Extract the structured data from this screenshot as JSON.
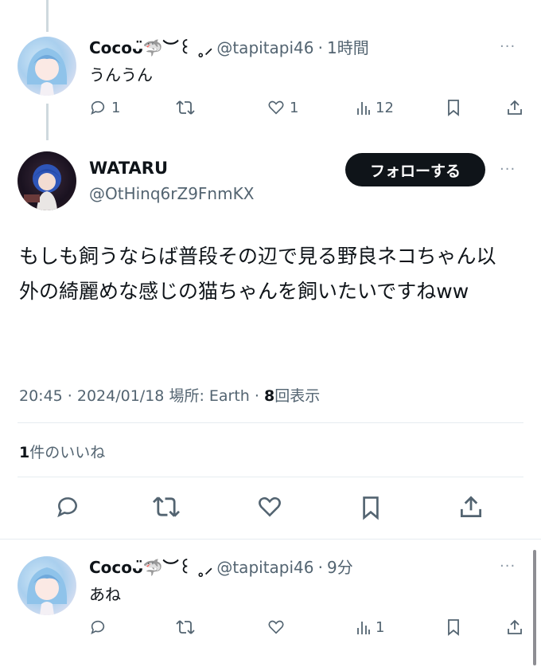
{
  "reply_top": {
    "display_name": "Coco",
    "name_emoji": "ᴗ̈🦈︶꒰ ˳⸝",
    "handle": "@tapitapi46",
    "separator": "·",
    "time": "1時間",
    "text": "うんうん",
    "actions": {
      "reply_count": "1",
      "retweet_count": "",
      "like_count": "1",
      "views_count": "12"
    }
  },
  "main": {
    "display_name": "WATARU",
    "handle": "@OtHinq6rZ9FnmKX",
    "follow_label": "フォローする",
    "text": "もしも飼うならば普段その辺で見る野良ネコちゃん以外の綺麗めな感じの猫ちゃんを飼いたいですねww",
    "timestamp": "20:45 · 2024/01/18",
    "location_label": "場所: Earth",
    "separator": "·",
    "views_count": "8",
    "views_label": "回表示",
    "likes_count": "1",
    "likes_label": "件のいいね"
  },
  "reply_bottom": {
    "display_name": "Coco",
    "name_emoji": "ᴗ̈🦈︶꒰ ˳⸝",
    "handle": "@tapitapi46",
    "separator": "·",
    "time": "9分",
    "text": "あね",
    "actions": {
      "reply_count": "",
      "retweet_count": "",
      "like_count": "",
      "views_count": "1"
    }
  },
  "more_glyph": "···",
  "colors": {
    "text": "#0f1419",
    "secondary": "#536471",
    "border": "#e6ecf0",
    "button_bg": "#0f1419"
  },
  "icons": [
    "reply-icon",
    "retweet-icon",
    "like-icon",
    "views-icon",
    "bookmark-icon",
    "share-icon",
    "more-icon"
  ]
}
